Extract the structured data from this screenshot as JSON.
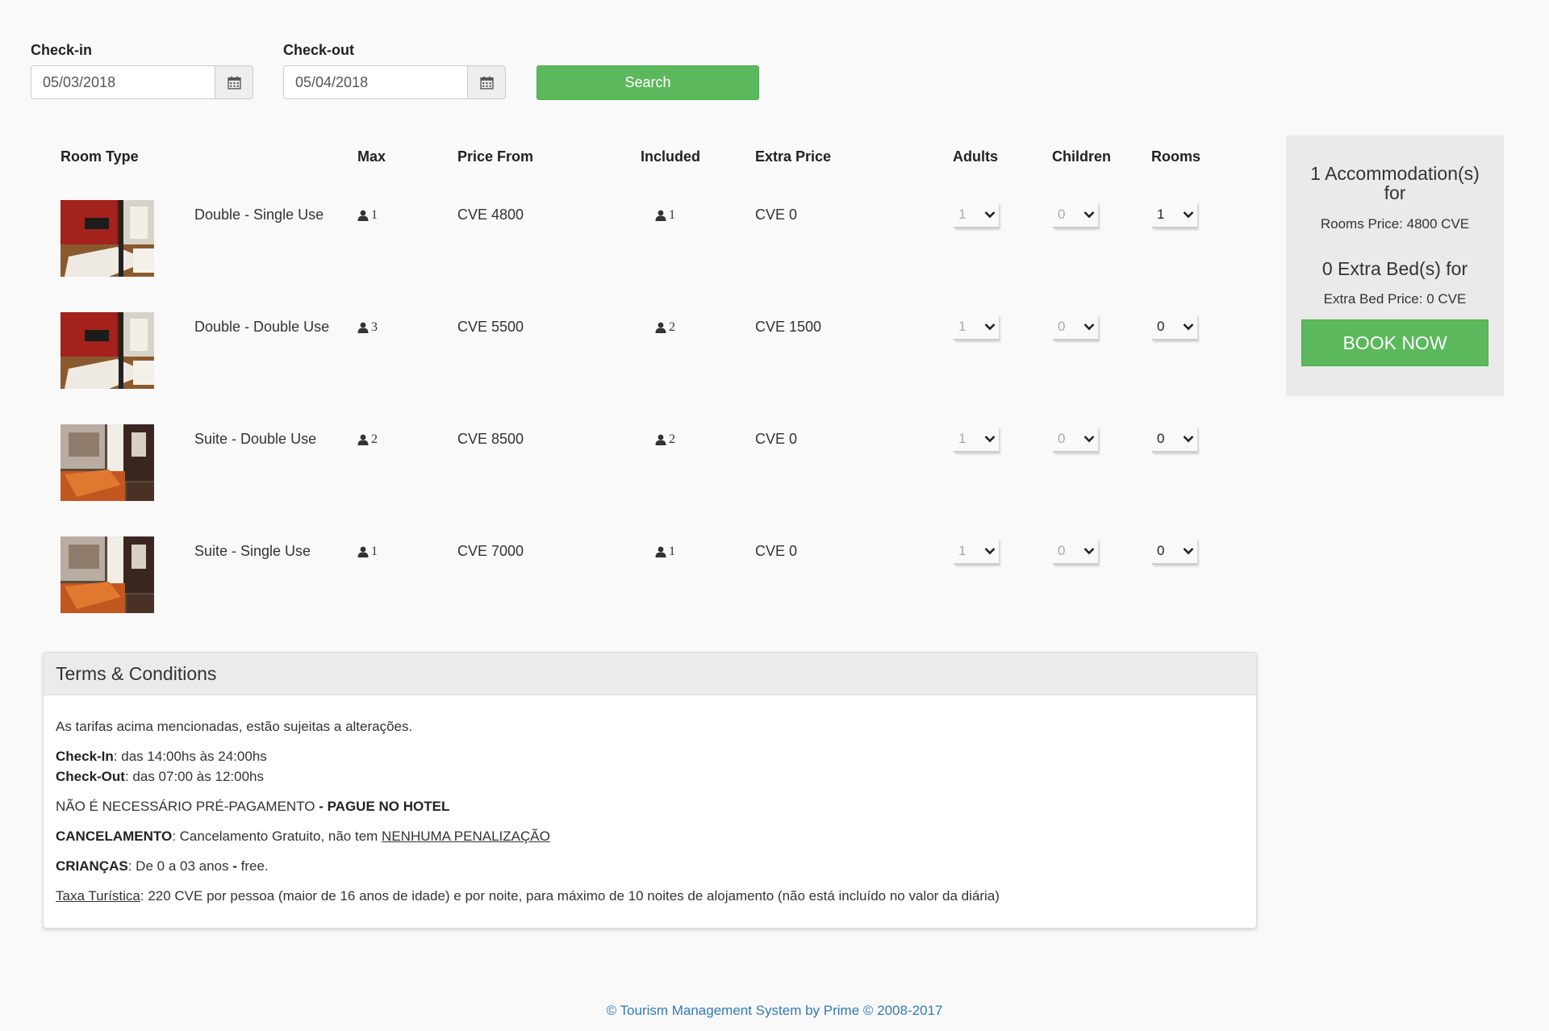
{
  "search": {
    "checkin_label": "Check-in",
    "checkin_value": "05/03/2018",
    "checkout_label": "Check-out",
    "checkout_value": "05/04/2018",
    "button": "Search"
  },
  "table": {
    "headers": {
      "room_type": "Room Type",
      "max": "Max",
      "price_from": "Price From",
      "included": "Included",
      "extra_price": "Extra Price",
      "adults": "Adults",
      "children": "Children",
      "rooms": "Rooms"
    },
    "rows": [
      {
        "name": "Double - Single Use",
        "max": "1",
        "price": "CVE 4800",
        "included": "1",
        "extra": "CVE 0",
        "adults": "1",
        "children": "0",
        "rooms": "1",
        "photo": "red-room"
      },
      {
        "name": "Double - Double Use",
        "max": "3",
        "price": "CVE 5500",
        "included": "2",
        "extra": "CVE 1500",
        "adults": "1",
        "children": "0",
        "rooms": "0",
        "photo": "red-room"
      },
      {
        "name": "Suite - Double Use",
        "max": "2",
        "price": "CVE 8500",
        "included": "2",
        "extra": "CVE 0",
        "adults": "1",
        "children": "0",
        "rooms": "0",
        "photo": "brown-suite"
      },
      {
        "name": "Suite - Single Use",
        "max": "1",
        "price": "CVE 7000",
        "included": "1",
        "extra": "CVE 0",
        "adults": "1",
        "children": "0",
        "rooms": "0",
        "photo": "brown-suite"
      }
    ]
  },
  "summary": {
    "accommodation_line1": "1 Accommodation(s)",
    "accommodation_line2": "for",
    "rooms_price": "Rooms Price: 4800 CVE",
    "extra_beds": "0 Extra Bed(s) for",
    "extra_bed_price": "Extra Bed Price: 0 CVE",
    "book_button": "BOOK NOW"
  },
  "terms": {
    "title": "Terms & Conditions",
    "line1": "As tarifas acima mencionadas, estão sujeitas a alterações.",
    "checkin_label": "Check-In",
    "checkin_text": ": das 14:00hs às 24:00hs",
    "checkout_label": "Check-Out",
    "checkout_text": ": das 07:00 às 12:00hs",
    "prepay_text": "NÃO É NECESSÁRIO PRÉ-PAGAMENTO ",
    "prepay_bold": "- PAGUE NO HOTEL",
    "cancel_label": "CANCELAMENTO",
    "cancel_text": ": Cancelamento Gratuito, não tem ",
    "cancel_link": "NENHUMA PENALIZAÇÃO",
    "children_label": "CRIANÇAS",
    "children_text": ": De 0 a 03 anos ",
    "children_bold": "-",
    "children_tail": " free.",
    "tax_link": "Taxa Turística",
    "tax_text": ": 220 CVE por pessoa (maior de 16 anos de idade) e por noite, para máximo de 10 noites de alojamento (não está incluído no valor da diária)"
  },
  "footer": "© Tourism Management System by Prime © 2008-2017",
  "colors": {
    "accent_green": "#5cb85c",
    "footer_link": "#337ab7"
  }
}
